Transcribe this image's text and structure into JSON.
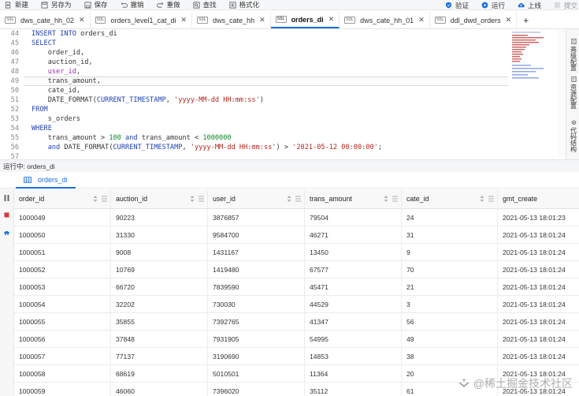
{
  "toolbar": {
    "items": [
      {
        "label": "新建",
        "icon": "file-plus-icon"
      },
      {
        "label": "另存为",
        "icon": "save-as-icon"
      },
      {
        "label": "保存",
        "icon": "save-icon"
      },
      {
        "label": "撤销",
        "icon": "undo-icon"
      },
      {
        "label": "重做",
        "icon": "redo-icon"
      },
      {
        "label": "查找",
        "icon": "search-icon"
      },
      {
        "label": "格式化",
        "icon": "format-icon"
      }
    ],
    "right_items": [
      {
        "label": "验证",
        "icon": "shield-check-icon"
      },
      {
        "label": "运行",
        "icon": "play-icon"
      },
      {
        "label": "上线",
        "icon": "cloud-upload-icon"
      },
      {
        "label": "提交",
        "icon": "submit-icon"
      }
    ]
  },
  "tabs": [
    {
      "label": "dws_cate_hh_02",
      "active": false
    },
    {
      "label": "orders_level1_cat_di",
      "active": false
    },
    {
      "label": "dws_cate_hh",
      "active": false
    },
    {
      "label": "orders_di",
      "active": true
    },
    {
      "label": "dws_cate_hh_01",
      "active": false
    },
    {
      "label": "ddl_dwd_orders",
      "active": false
    }
  ],
  "tab_icon_label": "SQL",
  "editor": {
    "line_numbers": [
      "44",
      "45",
      "46",
      "47",
      "48",
      "49",
      "50",
      "51",
      "52",
      "53",
      "54",
      "55",
      "56",
      "57"
    ]
  },
  "right_panel": [
    {
      "label": "高级配置"
    },
    {
      "label": "资源配置"
    },
    {
      "label": "代码结构"
    }
  ],
  "runbar": {
    "text": "运行中: orders_di"
  },
  "result_tab": {
    "label": "orders_di"
  },
  "table": {
    "columns": [
      "order_id",
      "auction_id",
      "user_id",
      "trans_amount",
      "cate_id",
      "gmt_create"
    ],
    "rows": [
      [
        "1000049",
        "90223",
        "3876857",
        "79504",
        "24",
        "2021-05-13 18:01:23"
      ],
      [
        "1000050",
        "31330",
        "9584700",
        "46271",
        "31",
        "2021-05-13 18:01:24"
      ],
      [
        "1000051",
        "9008",
        "1431167",
        "13450",
        "9",
        "2021-05-13 18:01:24"
      ],
      [
        "1000052",
        "10769",
        "1419480",
        "67577",
        "70",
        "2021-05-13 18:01:24"
      ],
      [
        "1000053",
        "66720",
        "7839590",
        "45471",
        "21",
        "2021-05-13 18:01:24"
      ],
      [
        "1000054",
        "32202",
        "730030",
        "44529",
        "3",
        "2021-05-13 18:01:24"
      ],
      [
        "1000055",
        "35855",
        "7392765",
        "41347",
        "56",
        "2021-05-13 18:01:24"
      ],
      [
        "1000056",
        "37848",
        "7931905",
        "54995",
        "49",
        "2021-05-13 18:01:24"
      ],
      [
        "1000057",
        "77137",
        "3190690",
        "14853",
        "38",
        "2021-05-13 18:01:24"
      ],
      [
        "1000058",
        "68619",
        "5010501",
        "11364",
        "20",
        "2021-05-13 18:01:24"
      ],
      [
        "1000059",
        "46060",
        "7396020",
        "35112",
        "61",
        "2021-05-13 18:01:24"
      ]
    ]
  },
  "watermark": {
    "text": "@稀土掘金技术社区"
  },
  "colors": {
    "accent": "#1b6fde",
    "keyword": "#1f3fb3",
    "string": "#b3261e",
    "number": "#0a8a2a",
    "column": "#9b2fae"
  }
}
